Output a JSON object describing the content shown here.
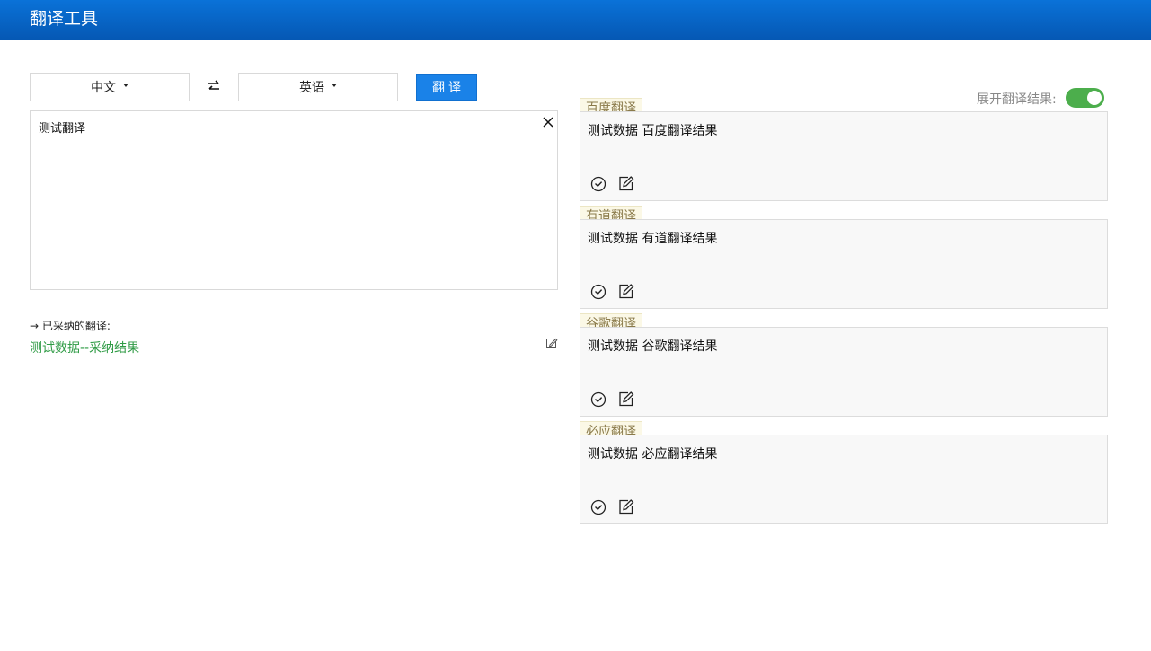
{
  "header": {
    "title": "翻译工具"
  },
  "toolbar": {
    "source_lang": "中文",
    "target_lang": "英语",
    "translate_label": "翻译"
  },
  "input": {
    "value": "测试翻译"
  },
  "adopted": {
    "label": "→ 已采纳的翻译:",
    "value": "测试数据--采纳结果"
  },
  "expand_toggle": {
    "label": "展开翻译结果:",
    "on": true
  },
  "results": [
    {
      "engine": "百度翻译",
      "text": "测试数据 百度翻译结果"
    },
    {
      "engine": "有道翻译",
      "text": "测试数据 有道翻译结果"
    },
    {
      "engine": "谷歌翻译",
      "text": "测试数据 谷歌翻译结果"
    },
    {
      "engine": "必应翻译",
      "text": "测试数据 必应翻译结果"
    }
  ],
  "colors": {
    "header": "#0a6ad0",
    "primary_button": "#1a82e8",
    "adopted_text": "#2f9b45",
    "toggle_on": "#4cae4c"
  }
}
